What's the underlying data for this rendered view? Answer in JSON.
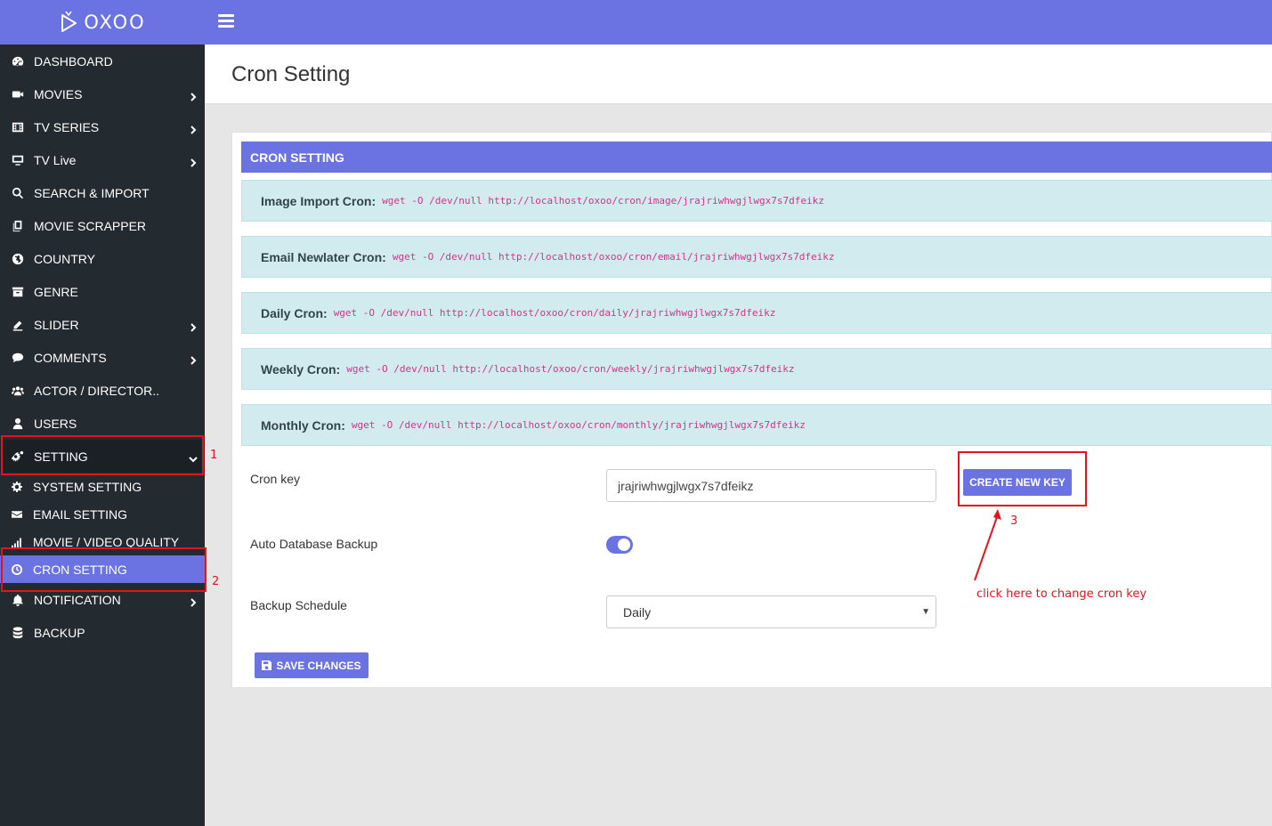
{
  "logo": {
    "text": "OXOO"
  },
  "sidebar": {
    "items": [
      {
        "label": "DASHBOARD",
        "icon": "dashboard-icon",
        "has_children": false
      },
      {
        "label": "MOVIES",
        "icon": "video-camera-icon",
        "has_children": true
      },
      {
        "label": "TV SERIES",
        "icon": "film-icon",
        "has_children": true
      },
      {
        "label": "TV Live",
        "icon": "monitor-icon",
        "has_children": true
      },
      {
        "label": "SEARCH & IMPORT",
        "icon": "search-icon",
        "has_children": false
      },
      {
        "label": "MOVIE SCRAPPER",
        "icon": "copy-icon",
        "has_children": false
      },
      {
        "label": "COUNTRY",
        "icon": "globe-icon",
        "has_children": false
      },
      {
        "label": "GENRE",
        "icon": "archive-icon",
        "has_children": false
      },
      {
        "label": "SLIDER",
        "icon": "sliders-icon",
        "has_children": true
      },
      {
        "label": "COMMENTS",
        "icon": "comment-icon",
        "has_children": true
      },
      {
        "label": "ACTOR / DIRECTOR..",
        "icon": "users-icon",
        "has_children": false
      },
      {
        "label": "USERS",
        "icon": "user-icon",
        "has_children": false
      },
      {
        "label": "SETTING",
        "icon": "gears-icon",
        "has_children": true,
        "expanded": true
      }
    ],
    "sub_items": [
      {
        "label": "SYSTEM SETTING",
        "icon": "gear-icon"
      },
      {
        "label": "EMAIL SETTING",
        "icon": "envelope-icon"
      },
      {
        "label": "MOVIE / VIDEO QUALITY",
        "icon": "signal-icon"
      },
      {
        "label": "CRON SETTING",
        "icon": "clock-icon",
        "active": true
      }
    ],
    "bottom_items": [
      {
        "label": "NOTIFICATION",
        "icon": "bell-icon",
        "has_children": true
      },
      {
        "label": "BACKUP",
        "icon": "database-icon",
        "has_children": false
      }
    ]
  },
  "page": {
    "title": "Cron Setting"
  },
  "panel": {
    "heading": "CRON SETTING",
    "crons": [
      {
        "label": "Image Import Cron:",
        "command": "wget -O /dev/null http://localhost/oxoo/cron/image/jrajriwhwgjlwgx7s7dfeikz"
      },
      {
        "label": "Email Newlater Cron:",
        "command": "wget -O /dev/null http://localhost/oxoo/cron/email/jrajriwhwgjlwgx7s7dfeikz"
      },
      {
        "label": "Daily Cron:",
        "command": "wget -O /dev/null http://localhost/oxoo/cron/daily/jrajriwhwgjlwgx7s7dfeikz"
      },
      {
        "label": "Weekly Cron:",
        "command": "wget -O /dev/null http://localhost/oxoo/cron/weekly/jrajriwhwgjlwgx7s7dfeikz"
      },
      {
        "label": "Monthly Cron:",
        "command": "wget -O /dev/null http://localhost/oxoo/cron/monthly/jrajriwhwgjlwgx7s7dfeikz"
      }
    ],
    "cron_key_label": "Cron key",
    "cron_key_value": "jrajriwhwgjlwgx7s7dfeikz",
    "create_key_label": "CREATE NEW KEY",
    "auto_backup_label": "Auto Database Backup",
    "auto_backup_enabled": true,
    "backup_schedule_label": "Backup Schedule",
    "backup_schedule_value": "Daily",
    "save_label": "SAVE CHANGES"
  },
  "annotations": {
    "num1": "1",
    "num2": "2",
    "num3": "3",
    "hint": "click here to change cron key"
  },
  "colors": {
    "accent": "#6b73e3",
    "sidebar_bg": "#232b30",
    "cron_box_bg": "#d2ebef",
    "command_text": "#d63384",
    "annotation_red": "#e3141d"
  }
}
